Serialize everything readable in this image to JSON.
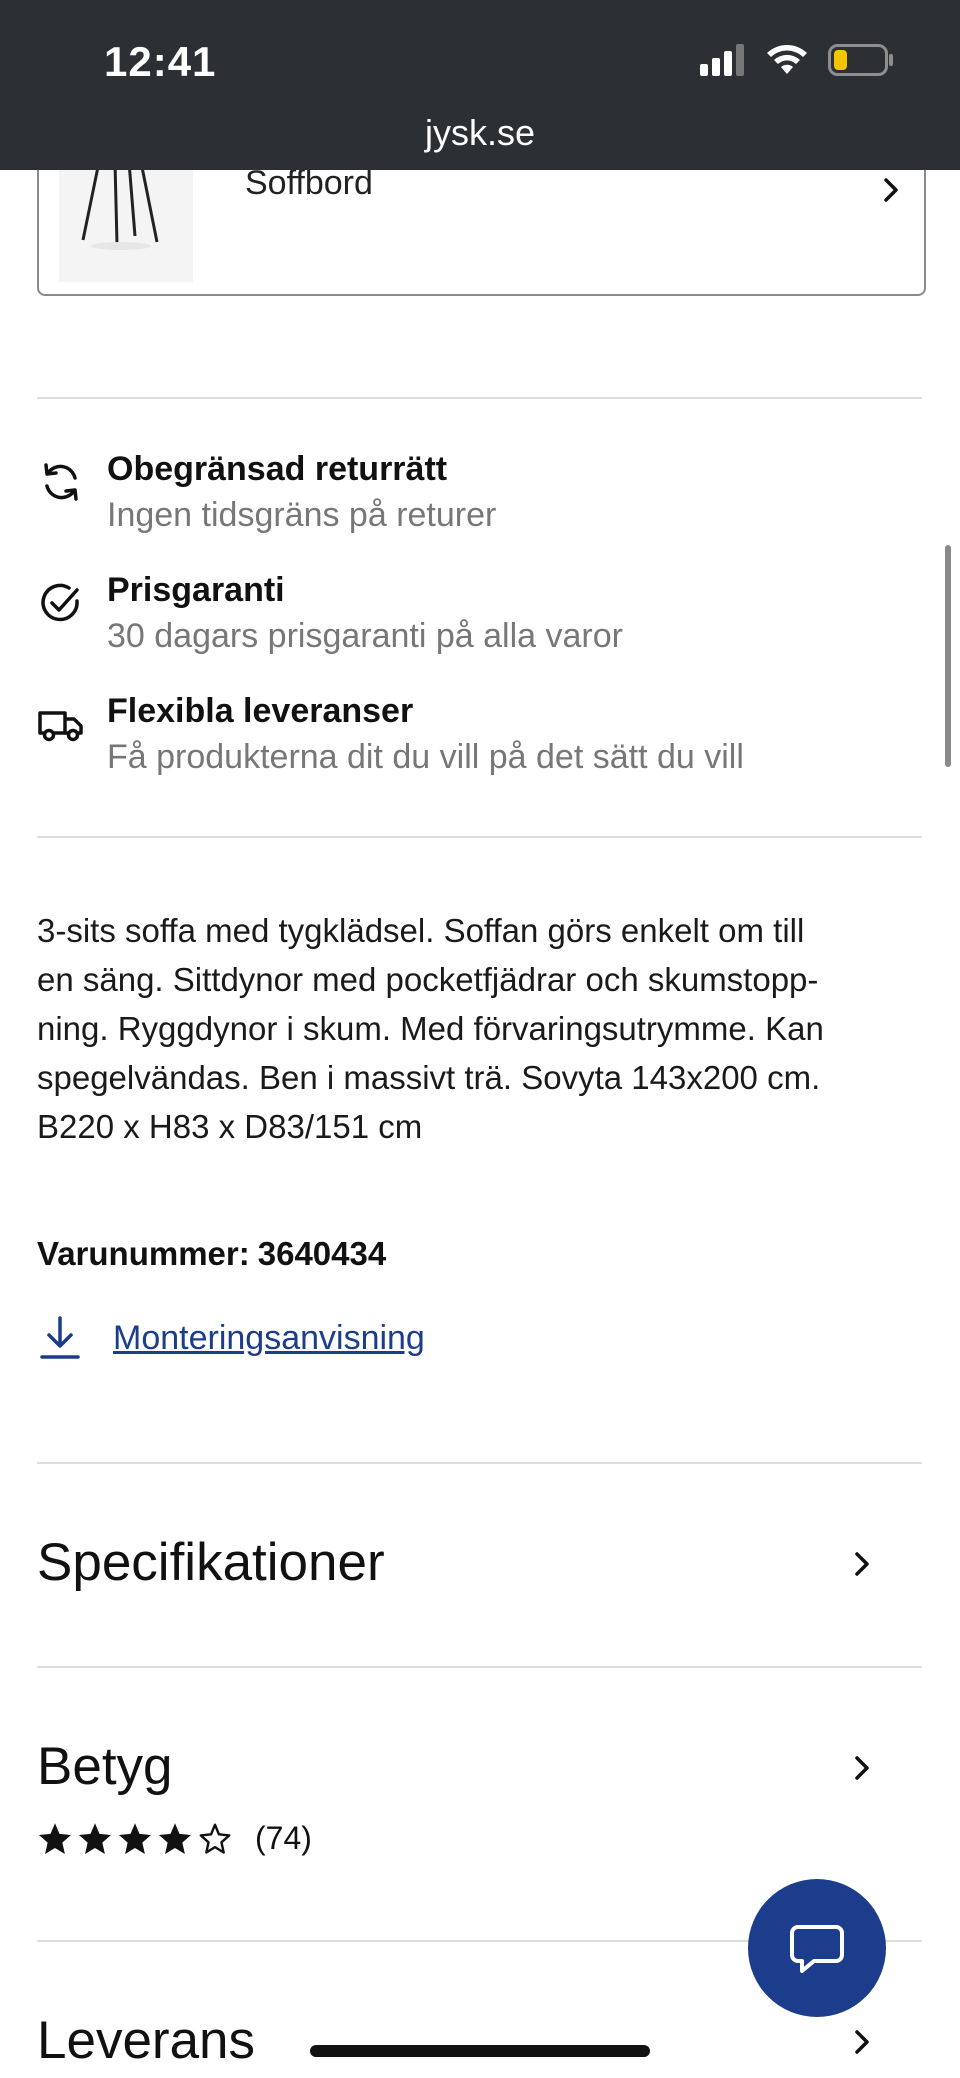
{
  "status_bar": {
    "time": "12:41",
    "url": "jysk.se"
  },
  "related": {
    "label": "Soffbord"
  },
  "usps": [
    {
      "icon": "return-arrows-icon",
      "title": "Obegränsad returrätt",
      "subtitle": "Ingen tidsgräns på returer"
    },
    {
      "icon": "check-circle-icon",
      "title": "Prisgaranti",
      "subtitle": "30 dagars prisgaranti på alla varor"
    },
    {
      "icon": "delivery-truck-icon",
      "title": "Flexibla leveranser",
      "subtitle": "Få produkterna dit du vill på det sätt du vill"
    }
  ],
  "description_lines": [
    "3-sits soffa med tygklädsel. Soffan görs enkelt om till",
    "en säng. Sittdynor med pocketfjädrar och skumstopp-",
    "ning. Ryggdynor i skum. Med förvaringsutrymme. Kan",
    "spegelvändas. Ben i massivt trä. Sovyta 143x200 cm.",
    "B220 x H83 x D83/151 cm"
  ],
  "sku": {
    "label": "Varunummer:",
    "value": "3640434"
  },
  "manual_link": "Monteringsanvisning",
  "sections": {
    "specs": "Specifikationer",
    "rating": "Betyg",
    "delivery": "Leverans"
  },
  "rating": {
    "stars_filled": 4,
    "stars_total": 5,
    "count": "(74)"
  },
  "colors": {
    "brand_blue": "#1c3d8c",
    "status_bar": "#2c2f33",
    "battery_low": "#f5c400"
  }
}
